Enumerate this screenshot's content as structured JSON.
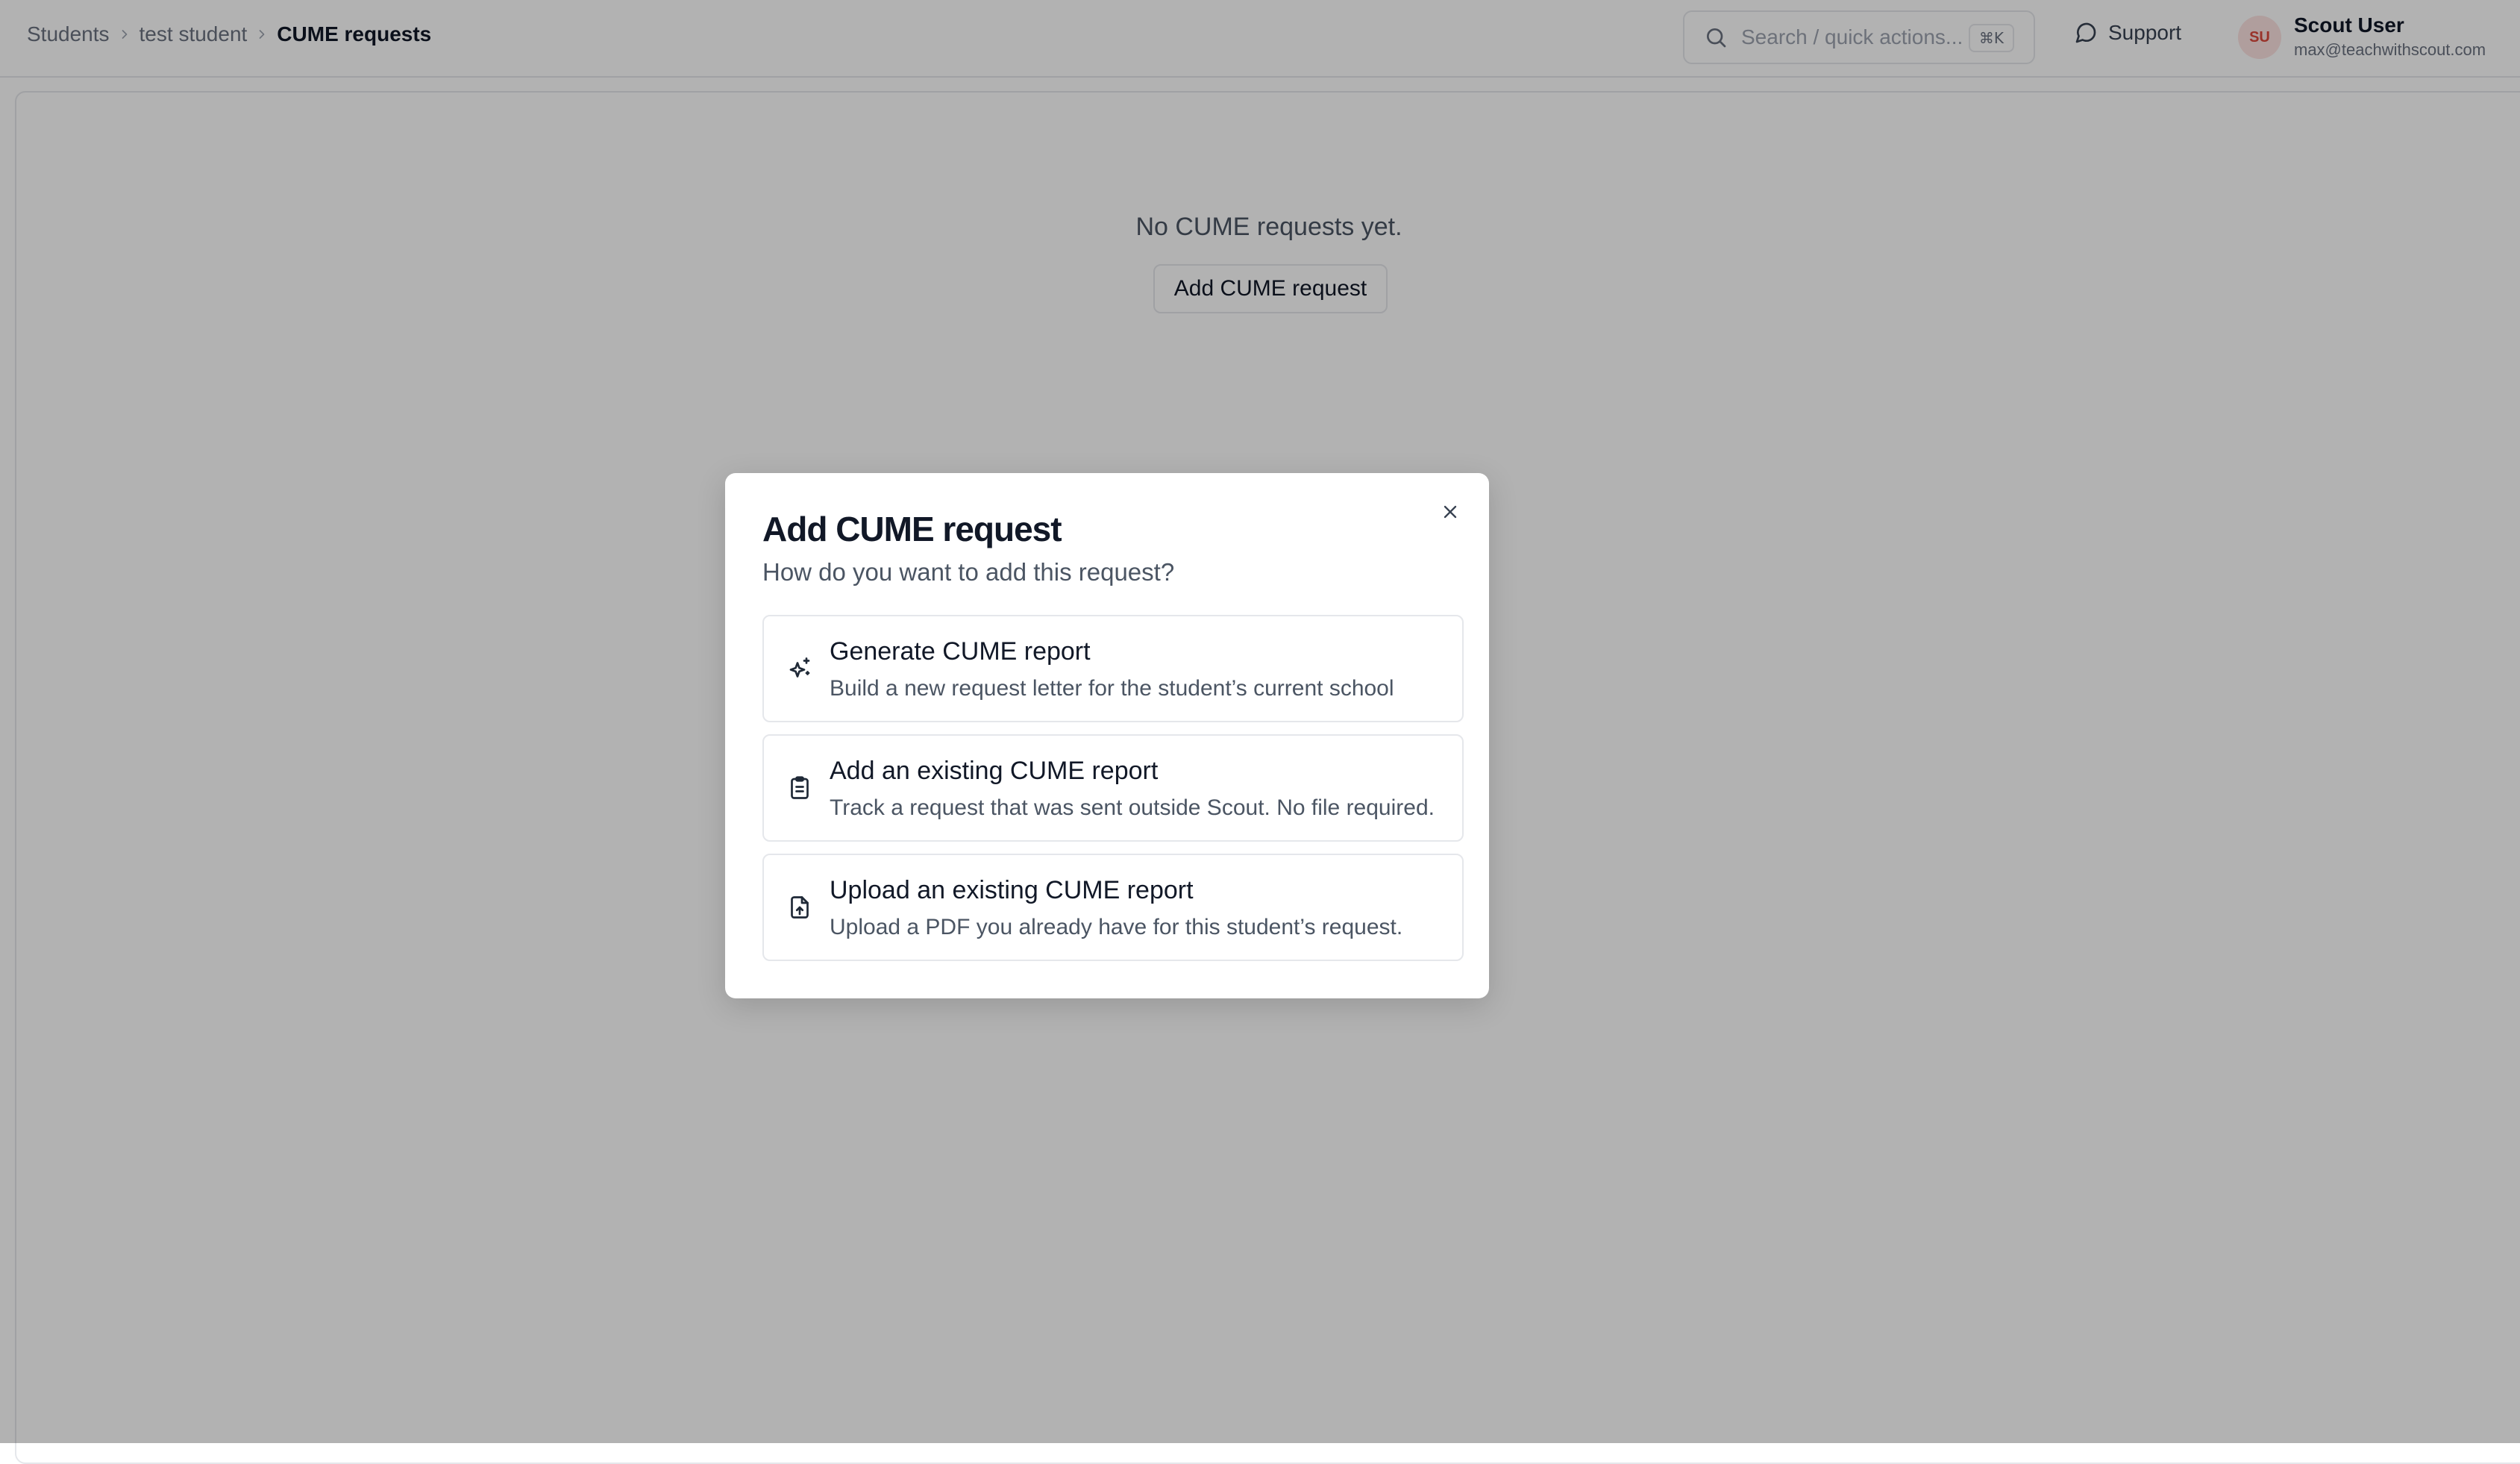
{
  "breadcrumb": {
    "items": [
      {
        "label": "Students"
      },
      {
        "label": "test student"
      },
      {
        "label": "CUME requests"
      }
    ]
  },
  "search": {
    "placeholder": "Search / quick actions...",
    "shortcut": "⌘K"
  },
  "support": {
    "label": "Support"
  },
  "user": {
    "initials": "SU",
    "name": "Scout User",
    "email": "max@teachwithscout.com"
  },
  "main": {
    "empty_text": "No CUME requests yet.",
    "add_button_label": "Add CUME request"
  },
  "modal": {
    "title": "Add CUME request",
    "subtitle": "How do you want to add this request?",
    "options": [
      {
        "icon": "sparkles-icon",
        "title": "Generate CUME report",
        "description": "Build a new request letter for the student’s current school"
      },
      {
        "icon": "clipboard-list-icon",
        "title": "Add an existing CUME report",
        "description": "Track a request that was sent outside Scout. No file required."
      },
      {
        "icon": "file-upload-icon",
        "title": "Upload an existing CUME report",
        "description": "Upload a PDF you already have for this student’s request."
      }
    ]
  },
  "colors": {
    "overlay": "rgba(0,0,0,0.30)",
    "avatar_bg": "#fde2e1",
    "avatar_text": "#dc4a3d",
    "border": "#e5e7eb"
  }
}
